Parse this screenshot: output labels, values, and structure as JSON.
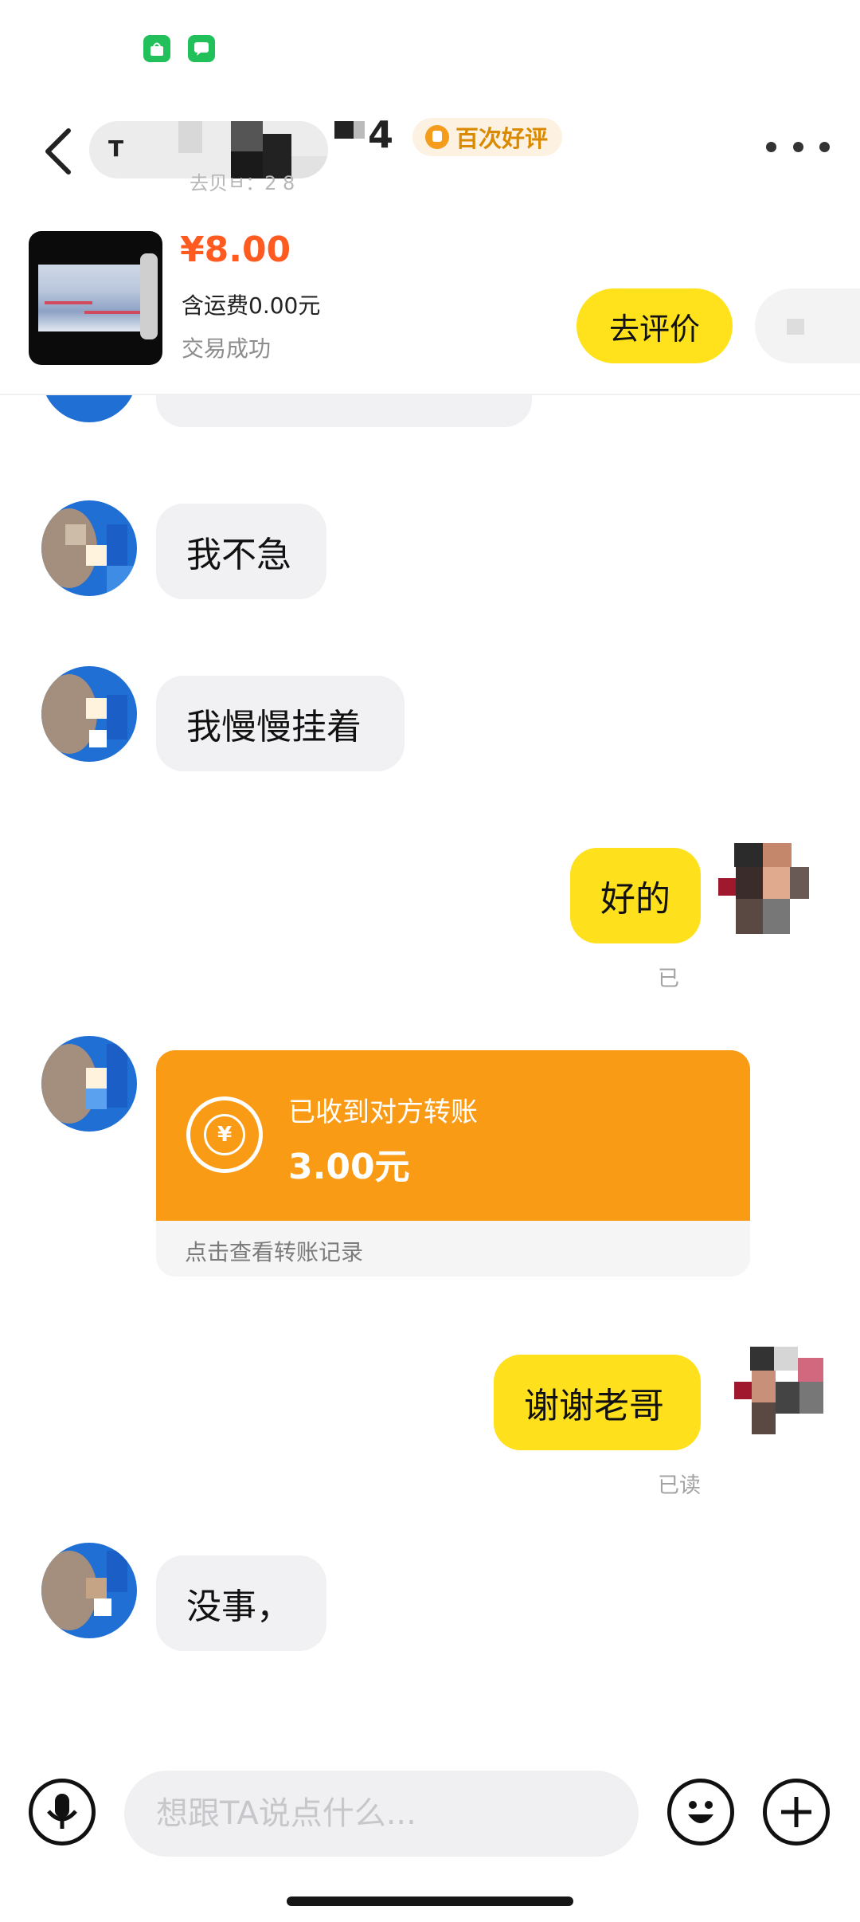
{
  "status_bar": {
    "icons": [
      "app-store-icon",
      "message-icon"
    ]
  },
  "header": {
    "name_prefix": "T",
    "name_suffix": "4",
    "badge_label": "百次好评",
    "subtitle": "去贝ㅂ：2 8"
  },
  "order": {
    "price": "¥8.00",
    "shipping": "含运费0.00元",
    "status": "交易成功",
    "review_button": "去评价"
  },
  "messages": [
    {
      "from": "other",
      "text": "我不急"
    },
    {
      "from": "other",
      "text": "我慢慢挂着"
    },
    {
      "from": "me",
      "text": "好的",
      "receipt": "已"
    },
    {
      "from": "other",
      "type": "transfer",
      "title": "已收到对方转账",
      "amount": "3.00元",
      "footer": "点击查看转账记录"
    },
    {
      "from": "me",
      "text": "谢谢老哥",
      "receipt": "已读"
    },
    {
      "from": "other",
      "text": "没事，"
    }
  ],
  "input_bar": {
    "placeholder": "想跟TA说点什么..."
  },
  "colors": {
    "accent_yellow": "#ffe21c",
    "price_orange": "#ff5a1f",
    "transfer_orange": "#fa9b16"
  }
}
